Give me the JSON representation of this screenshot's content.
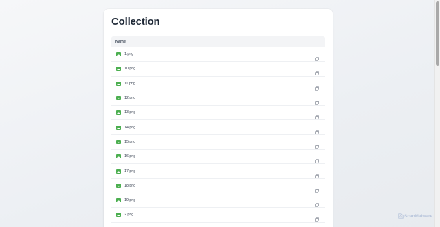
{
  "page": {
    "title": "Collection"
  },
  "table": {
    "header": "Name",
    "rows": [
      {
        "name": "1.png"
      },
      {
        "name": "10.png"
      },
      {
        "name": "11.png"
      },
      {
        "name": "12.png"
      },
      {
        "name": "13.png"
      },
      {
        "name": "14.png"
      },
      {
        "name": "15.png"
      },
      {
        "name": "16.png"
      },
      {
        "name": "17.png"
      },
      {
        "name": "18.png"
      },
      {
        "name": "19.png"
      },
      {
        "name": "2.png"
      }
    ]
  },
  "icons": {
    "file": "image-file-icon",
    "copy": "copy-icon"
  },
  "colors": {
    "file_icon": "#4caf50",
    "title": "#1f2937",
    "header_bg": "#f3f4f6",
    "watermark": "#b9c6dc"
  },
  "watermark": {
    "text": "ScanMalware"
  }
}
